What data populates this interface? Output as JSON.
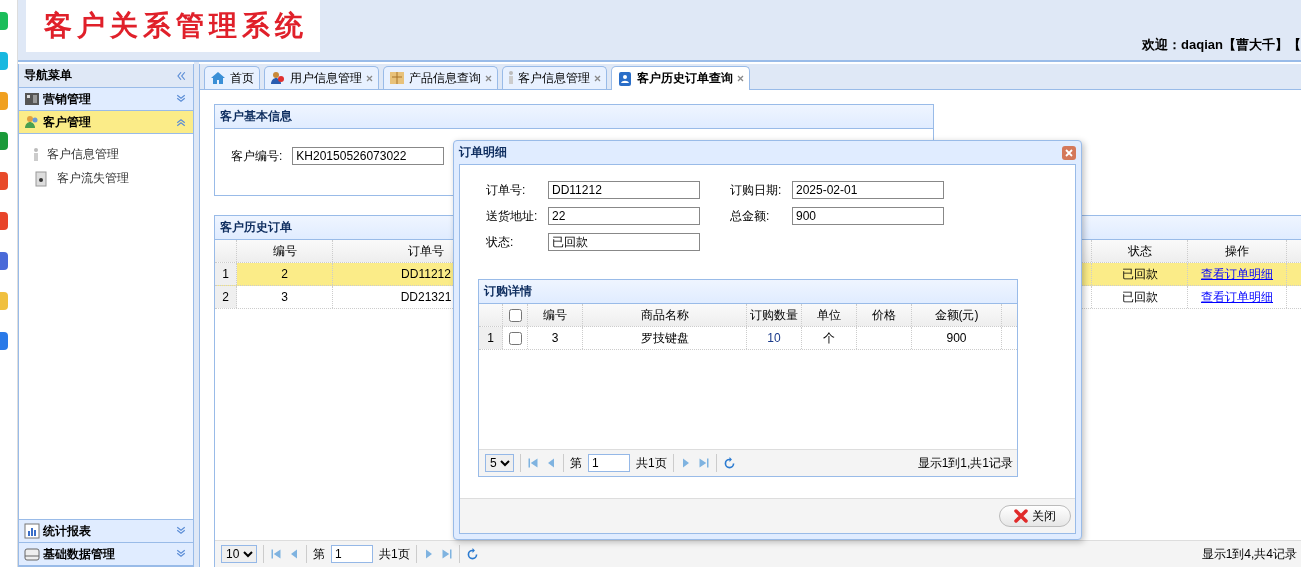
{
  "header": {
    "logo": "客户关系管理系统",
    "welcome": "欢迎：daqian【曹大千】【"
  },
  "sidebar": {
    "title": "导航菜单",
    "sections": [
      {
        "label": "营销管理",
        "expanded": false,
        "selected": false
      },
      {
        "label": "客户管理",
        "expanded": true,
        "selected": true,
        "children": [
          {
            "label": "客户信息管理"
          },
          {
            "label": "客户流失管理"
          }
        ]
      },
      {
        "label": "统计报表",
        "expanded": false,
        "selected": false
      },
      {
        "label": "基础数据管理",
        "expanded": false,
        "selected": false
      }
    ]
  },
  "tabs": [
    {
      "label": "首页",
      "selected": false,
      "closable": false
    },
    {
      "label": "用户信息管理",
      "selected": false,
      "closable": true
    },
    {
      "label": "产品信息查询",
      "selected": false,
      "closable": true
    },
    {
      "label": "客户信息管理",
      "selected": false,
      "closable": true
    },
    {
      "label": "客户历史订单查询",
      "selected": true,
      "closable": true
    }
  ],
  "basic_panel": {
    "title": "客户基本信息",
    "fields": [
      {
        "label": "客户编号:",
        "value": "KH20150526073022"
      }
    ]
  },
  "orders_panel": {
    "title": "客户历史订单",
    "columns": [
      "",
      "编号",
      "订单号",
      "状态",
      "操作"
    ],
    "rows": [
      {
        "selected": true,
        "cells": [
          "1",
          "2",
          "DD11212",
          "已回款",
          "查看订单明细"
        ]
      },
      {
        "selected": false,
        "cells": [
          "2",
          "3",
          "DD21321",
          "已回款",
          "查看订单明细"
        ]
      }
    ],
    "pager": {
      "page_size": "10",
      "page_label": "第",
      "page": "1",
      "total_pages": "共1页",
      "summary": "显示1到4,共4记录"
    }
  },
  "dialog": {
    "title": "订单明细",
    "fields": [
      {
        "label": "订单号:",
        "value": "DD11212"
      },
      {
        "label": "订购日期:",
        "value": "2025-02-01"
      },
      {
        "label": "送货地址:",
        "value": "22"
      },
      {
        "label": "总金额:",
        "value": "900"
      },
      {
        "label": "状态:",
        "value": "已回款"
      }
    ],
    "detail": {
      "title": "订购详情",
      "header_checked": false,
      "columns": [
        "",
        "",
        "编号",
        "商品名称",
        "订购数量",
        "单位",
        "价格",
        "金额(元)"
      ],
      "rows": [
        {
          "selected": false,
          "checked": false,
          "cells": [
            "1",
            "",
            "3",
            "罗技键盘",
            "10",
            "个",
            "",
            "900"
          ]
        }
      ],
      "pager": {
        "page_size": "5",
        "page_label": "第",
        "page": "1",
        "total_pages": "共1页",
        "summary": "显示1到1,共1记录"
      }
    },
    "close_button": "关闭"
  }
}
